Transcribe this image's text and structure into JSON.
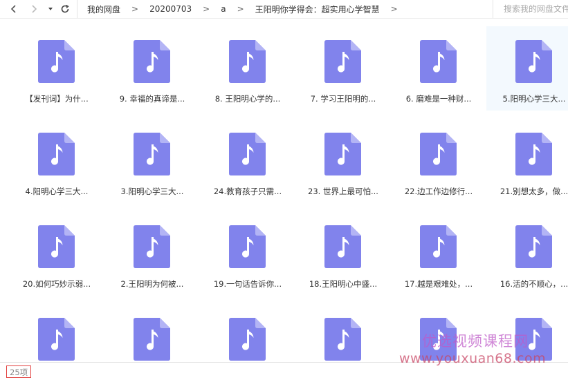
{
  "nav": {
    "back": "back-arrow",
    "forward": "forward-arrow",
    "history": "history-dropdown",
    "refresh": "refresh"
  },
  "breadcrumb": [
    "我的网盘",
    "20200703",
    "a",
    "王阳明你学得会：超实用心学智慧"
  ],
  "search": {
    "placeholder": "搜索我的网盘文件"
  },
  "files": [
    {
      "name": "【发刊词】为什..."
    },
    {
      "name": "9. 幸福的真谛是..."
    },
    {
      "name": "8. 王阳明心学的..."
    },
    {
      "name": "7. 学习王阳明的..."
    },
    {
      "name": "6. 磨难是一种财..."
    },
    {
      "name": "5.阳明心学三大...",
      "selected": true
    },
    {
      "name": "4.阳明心学三大..."
    },
    {
      "name": "3.阳明心学三大..."
    },
    {
      "name": "24.教育孩子只需..."
    },
    {
      "name": "23. 世界上最可怕..."
    },
    {
      "name": "22.边工作边修行..."
    },
    {
      "name": "21.别想太多，做..."
    },
    {
      "name": "20.如何巧妙示弱..."
    },
    {
      "name": "2.王阳明为何被..."
    },
    {
      "name": "19.一句话告诉你..."
    },
    {
      "name": "18.王阳明心中盛..."
    },
    {
      "name": "17.越是艰难处，..."
    },
    {
      "name": "16.活的不顺心，..."
    },
    {
      "name": ""
    },
    {
      "name": ""
    },
    {
      "name": ""
    },
    {
      "name": ""
    },
    {
      "name": ""
    },
    {
      "name": ""
    }
  ],
  "file_icon": "music-file-icon",
  "colors": {
    "icon_bg": "#8183ec",
    "icon_fold": "#b3b4f5",
    "selected_bg": "#f3f9fe",
    "count_border": "#e2403e"
  },
  "status": {
    "count": "25项"
  },
  "watermark": {
    "line1": "优选视频课程网",
    "line2": "www.youxuan68.com"
  }
}
